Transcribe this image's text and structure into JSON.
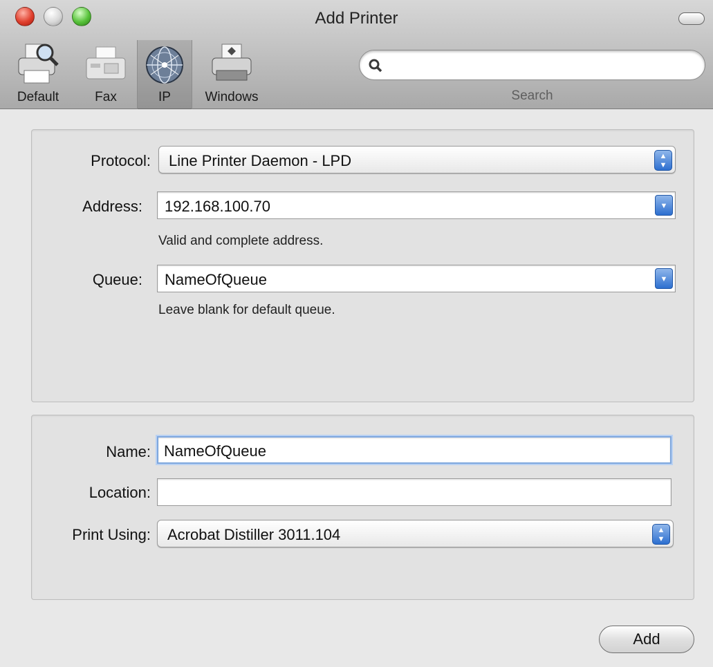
{
  "window": {
    "title": "Add Printer"
  },
  "toolbar": {
    "items": [
      {
        "label": "Default",
        "icon": "default-printer-icon"
      },
      {
        "label": "Fax",
        "icon": "fax-icon"
      },
      {
        "label": "IP",
        "icon": "globe-icon",
        "selected": true
      },
      {
        "label": "Windows",
        "icon": "windows-printer-icon"
      }
    ],
    "search_label": "Search",
    "search_value": ""
  },
  "connection": {
    "protocol_label": "Protocol:",
    "protocol_value": "Line Printer Daemon - LPD",
    "address_label": "Address:",
    "address_value": "192.168.100.70",
    "address_hint": "Valid and complete address.",
    "queue_label": "Queue:",
    "queue_value": "NameOfQueue",
    "queue_hint": "Leave blank for default queue."
  },
  "details": {
    "name_label": "Name:",
    "name_value": "NameOfQueue",
    "location_label": "Location:",
    "location_value": "",
    "print_using_label": "Print Using:",
    "print_using_value": "Acrobat Distiller 3011.104"
  },
  "buttons": {
    "add_label": "Add"
  },
  "colors": {
    "accent": "#2d6fd0",
    "focus_ring": "#7ea7de"
  }
}
